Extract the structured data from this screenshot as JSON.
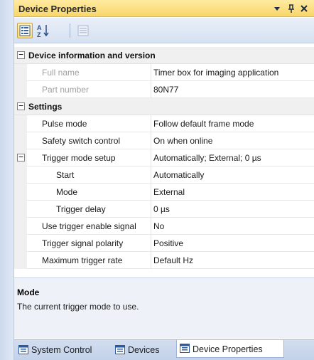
{
  "window": {
    "title": "Device Properties"
  },
  "titlebar": {
    "dropdown_glyph": "▾",
    "pin_glyph": "ꟷ",
    "close_glyph": "×",
    "pin_label": "⫠",
    "close_label": "X"
  },
  "toolbar": {
    "buttons": [
      "categorized",
      "alphabetical",
      "property-pages"
    ],
    "sort_label": "A\nZ"
  },
  "grid": {
    "categories": [
      {
        "label": "Device information and version",
        "expander": "−",
        "rows": [
          {
            "name": "Full name",
            "value": "Timer box for imaging application",
            "disabled": true
          },
          {
            "name": "Part number",
            "value": "80N77",
            "disabled": true
          }
        ]
      },
      {
        "label": "Settings",
        "expander": "−",
        "rows": [
          {
            "name": "Pulse mode",
            "value": "Follow default frame mode"
          },
          {
            "name": "Safety switch control",
            "value": "On when online"
          },
          {
            "name": "Trigger mode setup",
            "value": "Automatically; External; 0 µs",
            "expander": "−"
          },
          {
            "name": "Start",
            "value": "Automatically",
            "indent": true
          },
          {
            "name": "Mode",
            "value": "External",
            "indent": true
          },
          {
            "name": "Trigger delay",
            "value": "0 µs",
            "indent": true
          },
          {
            "name": "Use trigger enable signal",
            "value": "No"
          },
          {
            "name": "Trigger signal polarity",
            "value": "Positive"
          },
          {
            "name": "Maximum trigger rate",
            "value": "Default Hz"
          }
        ]
      }
    ]
  },
  "description": {
    "title": "Mode",
    "text": "The current trigger mode to use."
  },
  "tabs": [
    {
      "label": "System Control",
      "selected": false
    },
    {
      "label": "Devices",
      "selected": false
    },
    {
      "label": "Device Properties",
      "selected": true
    }
  ],
  "colors": {
    "titlebar": "#f9d66a",
    "toolbar": "#d6e1f1",
    "category": "#f0f0f0",
    "description": "#eef2f8"
  }
}
